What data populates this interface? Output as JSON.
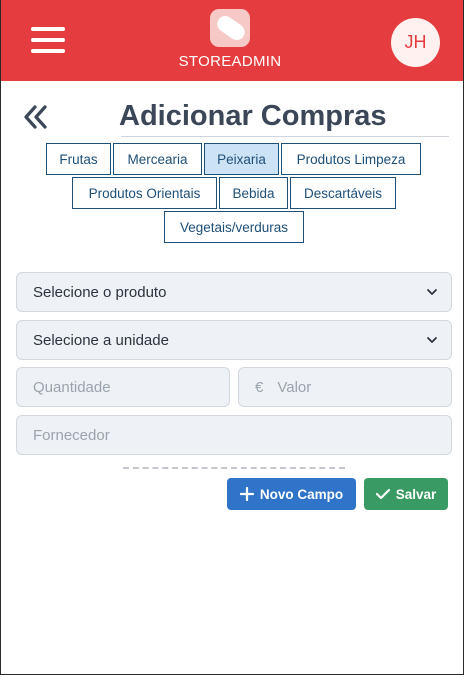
{
  "header": {
    "brand": "STOREADMIN",
    "avatar_initials": "JH",
    "color_bg": "#e53d3f"
  },
  "page": {
    "title": "Adicionar Compras"
  },
  "categories": [
    {
      "label": "Frutas",
      "active": false
    },
    {
      "label": "Mercearia",
      "active": false
    },
    {
      "label": "Peixaria",
      "active": true
    },
    {
      "label": "Produtos Limpeza",
      "active": false
    },
    {
      "label": "Produtos Orientais",
      "active": false
    },
    {
      "label": "Bebida",
      "active": false
    },
    {
      "label": "Descartáveis",
      "active": false
    },
    {
      "label": "Vegetais/verduras",
      "active": false
    }
  ],
  "form": {
    "product_select": "Selecione o produto",
    "unit_select": "Selecione a unidade",
    "quantity_placeholder": "Quantidade",
    "currency_symbol": "€",
    "value_placeholder": "Valor",
    "supplier_placeholder": "Fornecedor"
  },
  "actions": {
    "new_field_label": "Novo Campo",
    "save_label": "Salvar"
  }
}
